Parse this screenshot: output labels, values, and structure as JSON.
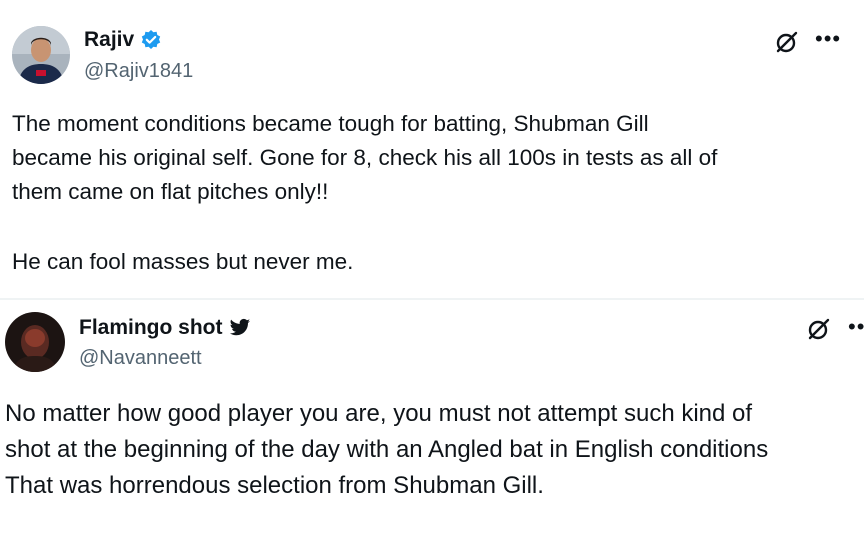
{
  "tweets": [
    {
      "name": "Rajiv",
      "handle": "@Rajiv1841",
      "badge": "verified-badge-icon",
      "lines": [
        "The moment conditions became tough for batting, Shubman Gill",
        "became his original self. Gone for 8, check his all 100s in tests as all of",
        "them came on flat pitches only!!",
        "He can fool masses but never me."
      ]
    },
    {
      "name": "Flamingo shot",
      "handle": "@Navanneett",
      "badge": "twitter-bird-icon",
      "lines": [
        "No matter how good player you are, you must not attempt such kind of",
        "shot at the beginning of the day with an Angled bat in English conditions",
        "That was horrendous selection from Shubman Gill."
      ]
    }
  ],
  "colors": {
    "verified": "#1d9bf0",
    "handle": "#536471",
    "text": "#0f1419"
  }
}
